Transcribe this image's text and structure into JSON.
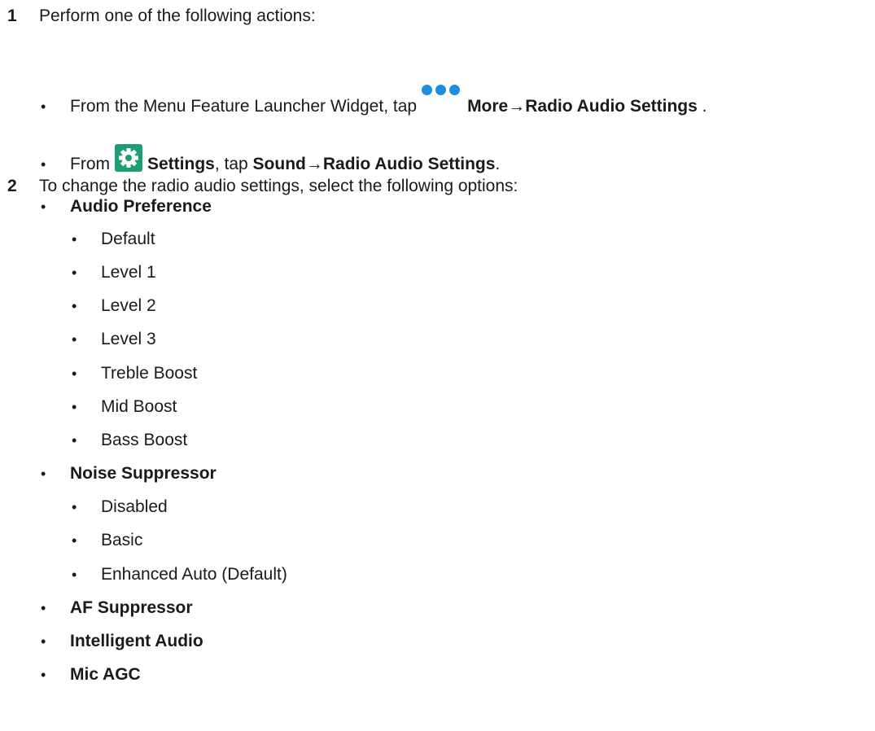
{
  "step1": {
    "number": "1",
    "text": "Perform one of the following actions:",
    "option_a": {
      "prefix": "From the Menu Feature Launcher Widget, tap",
      "bold": "More→Radio Audio Settings",
      "suffix": " ."
    },
    "option_b": {
      "prefix": "From",
      "bold1": "Settings",
      "middle": ", tap ",
      "bold2": "Sound→Radio Audio Settings",
      "suffix": "."
    }
  },
  "step2": {
    "number": "2",
    "text": "To change the radio audio settings, select the following options:",
    "audio_preference": {
      "label": "Audio Preference",
      "options": [
        "Default",
        "Level 1",
        "Level 2",
        "Level 3",
        "Treble Boost",
        "Mid Boost",
        "Bass Boost"
      ]
    },
    "noise_suppressor": {
      "label": "Noise Suppressor",
      "options": [
        "Disabled",
        "Basic",
        "Enhanced Auto (Default)"
      ]
    },
    "af_suppressor": "AF Suppressor",
    "intelligent_audio": "Intelligent Audio",
    "mic_agc": "Mic AGC"
  },
  "bullet": "•",
  "icons": {
    "more": "more-dots-icon",
    "settings": "settings-gear-icon"
  },
  "colors": {
    "more_dots": "#1a8fe0",
    "settings_bg": "#1b9e73"
  }
}
